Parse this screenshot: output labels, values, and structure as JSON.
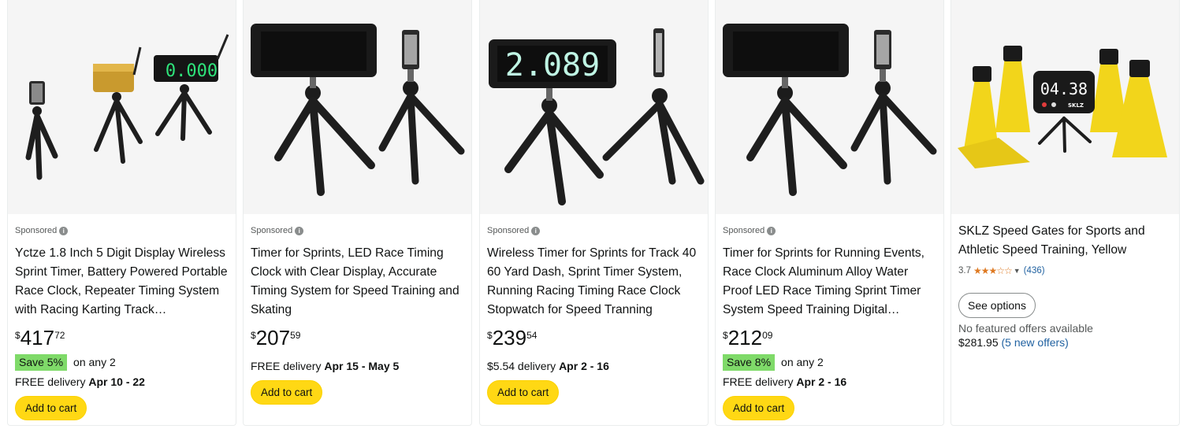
{
  "cards": [
    {
      "image_alt": "Wireless sprint timer with display, tripods and repeater",
      "sponsored": "Sponsored",
      "title": "Yctze 1.8 Inch 5 Digit Display Wireless Sprint Timer, Battery Powered Portable Race Clock, Repeater Timing System with Racing Karting Track…",
      "price_symbol": "$",
      "price_whole": "417",
      "price_fraction": "72",
      "badge": "Save 5%",
      "badge_suffix": "on any 2",
      "delivery_prefix": "FREE delivery",
      "delivery_dates": "Apr 10 - 22",
      "button": "Add to cart",
      "display_digits": "0.000"
    },
    {
      "image_alt": "LED race timing clock on tripod with sensor",
      "sponsored": "Sponsored",
      "title": "Timer for Sprints, LED Race Timing Clock with Clear Display, Accurate Timing System for Speed Training and Skating",
      "price_symbol": "$",
      "price_whole": "207",
      "price_fraction": "59",
      "delivery_prefix": "FREE delivery",
      "delivery_dates": "Apr 15 - May 5",
      "button": "Add to cart"
    },
    {
      "image_alt": "Wireless timer showing 2.089 on tripod with sensor",
      "sponsored": "Sponsored",
      "title": "Wireless Timer for Sprints for Track 40 60 Yard Dash, Sprint Timer System, Running Racing Timing Race Clock Stopwatch for Speed Tranning",
      "price_symbol": "$",
      "price_whole": "239",
      "price_fraction": "54",
      "delivery_prefix": "$5.54 delivery",
      "delivery_dates": "Apr 2 - 16",
      "button": "Add to cart",
      "display_digits": "2.089"
    },
    {
      "image_alt": "Race clock aluminum alloy with tripod and sensor",
      "sponsored": "Sponsored",
      "title": "Timer for Sprints for Running Events, Race Clock Aluminum Alloy Water Proof LED Race Timing Sprint Timer System Speed Training Digital…",
      "price_symbol": "$",
      "price_whole": "212",
      "price_fraction": "09",
      "badge": "Save 8%",
      "badge_suffix": "on any 2",
      "delivery_prefix": "FREE delivery",
      "delivery_dates": "Apr 2 - 16",
      "button": "Add to cart"
    },
    {
      "image_alt": "SKLZ speed gates yellow cones with timer display",
      "title": "SKLZ Speed Gates for Sports and Athletic Speed Training, Yellow",
      "rating_value": "3.7",
      "stars": "★★★☆☆",
      "rating_count": "(436)",
      "button": "See options",
      "no_offers": "No featured offers available",
      "used_price": "$281.95",
      "used_offers": "(5 new offers)",
      "display_digits": "04.38",
      "brand": "SKLZ"
    }
  ],
  "colors": {
    "add_to_cart": "#ffd814",
    "save_badge": "#7fda69",
    "star": "#de7921",
    "link": "#2162a1",
    "cone": "#f2d51b",
    "led_green": "#2ee37a",
    "led_mint": "#bff5e4"
  }
}
